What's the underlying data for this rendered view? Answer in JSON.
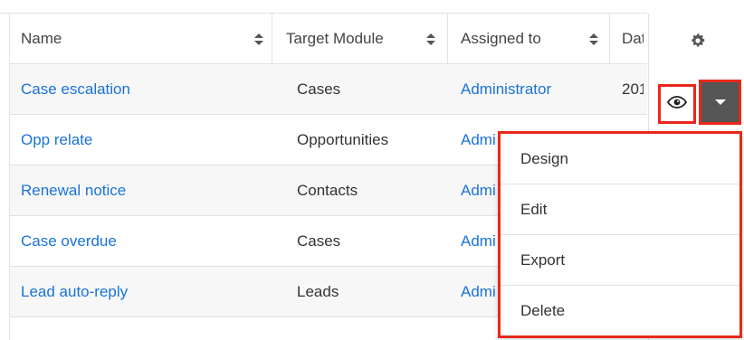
{
  "table": {
    "headers": {
      "name": "Name",
      "target_module": "Target Module",
      "assigned_to": "Assigned to",
      "date": "Dat"
    },
    "rows": [
      {
        "name": "Case escalation",
        "target_module": "Cases",
        "assigned_to": "Administrator",
        "date": "201"
      },
      {
        "name": "Opp relate",
        "target_module": "Opportunities",
        "assigned_to": "Admi",
        "date": ""
      },
      {
        "name": "Renewal notice",
        "target_module": "Contacts",
        "assigned_to": "Admi",
        "date": ""
      },
      {
        "name": "Case overdue",
        "target_module": "Cases",
        "assigned_to": "Admi",
        "date": ""
      },
      {
        "name": "Lead auto-reply",
        "target_module": "Leads",
        "assigned_to": "Admi",
        "date": ""
      }
    ]
  },
  "actions": {
    "settings_icon": "gear-icon",
    "preview_icon": "eye-icon",
    "menu_icon": "caret-down-icon",
    "highlight_color": "#e8281b"
  },
  "dropdown": {
    "items": [
      "Design",
      "Edit",
      "Export",
      "Delete"
    ]
  }
}
